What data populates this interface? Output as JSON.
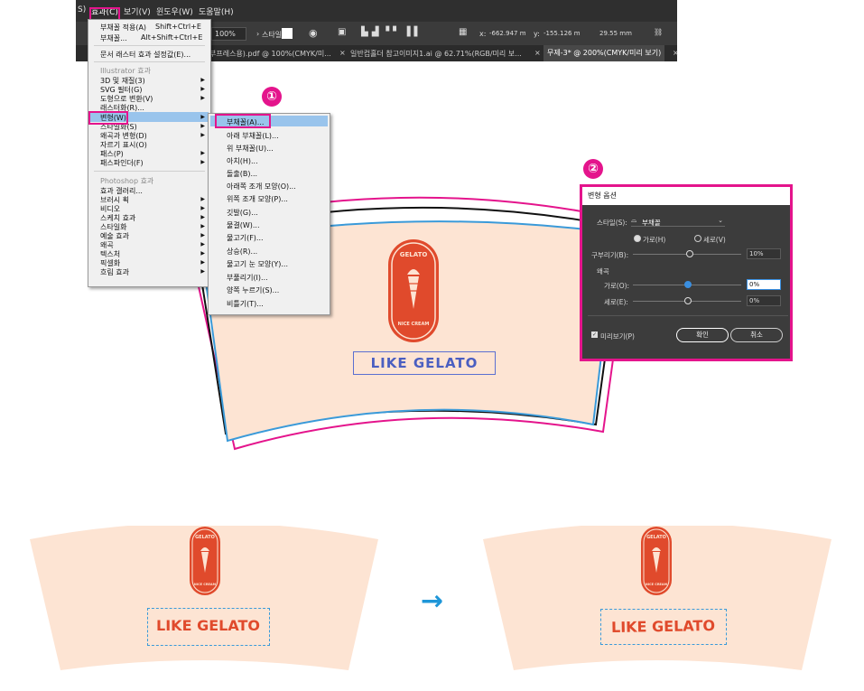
{
  "menubar": {
    "items": [
      "S)",
      "효과(C)",
      "보기(V)",
      "윈도우(W)",
      "도움말(H)"
    ]
  },
  "optbar": {
    "zoom": "100%",
    "style_label": "스타일",
    "x_label": "x:",
    "x_value": "-662.947 m",
    "y_label": "y:",
    "y_value": "-155.126 m",
    "w_value": "29.55 mm"
  },
  "tabs": [
    "부프레스용).pdf @ 100%(CMYK/미...",
    "일반컵홀더 참고이미지1.ai @ 62.71%(RGB/미리 보...",
    "무제-3* @ 200%(CMYK/미리 보기)"
  ],
  "effect_menu": {
    "apply_last": "부채꼴 적용(A)",
    "apply_last_shortcut": "Shift+Ctrl+E",
    "last": "부채꼴...",
    "last_shortcut": "Alt+Shift+Ctrl+E",
    "raster_settings": "문서 래스터 효과 설정값(E)...",
    "illustrator_header": "Illustrator 효과",
    "illustrator_items": [
      "3D 및 재질(3)",
      "SVG 필터(G)",
      "도형으로 변환(V)",
      "래스터화(R)...",
      "변형(W)",
      "스타일화(S)",
      "왜곡과 변형(D)",
      "자르기 표시(O)",
      "패스(P)",
      "패스파인더(F)"
    ],
    "photoshop_header": "Photoshop 효과",
    "photoshop_items": [
      "효과 갤러리...",
      "브러시 획",
      "비디오",
      "스케치 효과",
      "스타일화",
      "예술 효과",
      "왜곡",
      "텍스처",
      "픽셀화",
      "흐림 효과"
    ]
  },
  "warp_submenu": {
    "items": [
      "부채꼴(A)...",
      "아래 부채꼴(L)...",
      "위 부채꼴(U)...",
      "아치(H)...",
      "돌출(B)...",
      "아래쪽 조개 모양(O)...",
      "위쪽 조개 모양(P)...",
      "깃발(G)...",
      "물결(W)...",
      "물고기(F)...",
      "상승(R)...",
      "물고기 눈 모양(Y)...",
      "부풀리기(I)...",
      "양쪽 누르기(S)...",
      "비틀기(T)..."
    ]
  },
  "steps": {
    "one": "①",
    "two": "②"
  },
  "warp_dialog": {
    "title": "변형 옵션",
    "style_label": "스타일(S):",
    "style_value": "부채꼴",
    "horizontal": "가로(H)",
    "vertical": "세로(V)",
    "bend_label": "구부리기(B):",
    "bend_value": "10%",
    "distortion_header": "왜곡",
    "dist_h_label": "가로(O):",
    "dist_h_value": "0%",
    "dist_v_label": "세로(E):",
    "dist_v_value": "0%",
    "preview": "미리보기(P)",
    "ok": "확인",
    "cancel": "취소"
  },
  "cup": {
    "badge_top": "GELATO",
    "badge_bottom": "NICE CREAM",
    "headline": "LIKE GELATO"
  },
  "arrow": "→",
  "colors": {
    "accent_pink": "#e4148c",
    "cup_fill": "#fde4d3",
    "badge_red": "#e04a2c",
    "text_blue": "#4a5fc1",
    "select_blue": "#3a9ad9",
    "arrow_blue": "#1e96d8"
  }
}
